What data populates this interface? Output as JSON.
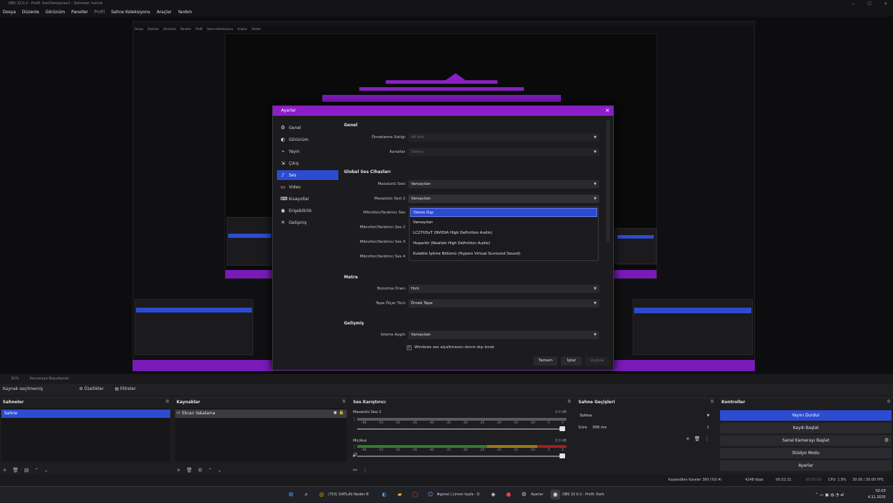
{
  "window": {
    "title": "OBS 32.0.2 - Profil: KartZamparası1 - Sahneler: komut",
    "controls": [
      "—",
      "☐",
      "✕"
    ]
  },
  "menu": [
    "Dosya",
    "Düzenle",
    "Görünüm",
    "Paneller",
    "Profil",
    "Sahne Koleksiyonu",
    "Araçlar",
    "Yardım"
  ],
  "nested_menu": [
    "Dosya",
    "Düzenle",
    "Görünüm",
    "Paneller",
    "Profil",
    "Sahne Koleksiyonu",
    "Araçlar",
    "Yardım"
  ],
  "dialog": {
    "title": "Ayarlar",
    "close": "✕",
    "nav": [
      {
        "label": "Genel",
        "icon": "⚙"
      },
      {
        "label": "Görünüm",
        "icon": "◐"
      },
      {
        "label": "Yayın",
        "icon": "⌁"
      },
      {
        "label": "Çıkış",
        "icon": "⇲"
      },
      {
        "label": "Ses",
        "icon": "♪"
      },
      {
        "label": "Video",
        "icon": "▭"
      },
      {
        "label": "Kısayollar",
        "icon": "⌨"
      },
      {
        "label": "Erişebilirlik",
        "icon": "◉"
      },
      {
        "label": "Gelişmiş",
        "icon": "✕"
      }
    ],
    "active_nav": "Ses",
    "sections": {
      "general": "Genel",
      "global_audio": "Global Ses Cihazları",
      "meters": "Metre",
      "advanced": "Gelişmiş"
    },
    "fields": {
      "sample_rate": {
        "label": "Örnekleme Sıklığı",
        "value": "48 kHz"
      },
      "channels": {
        "label": "Kanallar",
        "value": "Stereo"
      },
      "desktop1": {
        "label": "Masaüstü Sesi",
        "value": "Varsayılan"
      },
      "desktop2": {
        "label": "Masaüstü Sesi 2",
        "value": "Varsayılan"
      },
      "mic1": {
        "label": "Mikrofon/Yardımcı Ses"
      },
      "mic2": {
        "label": "Mikrofon/Yardımcı Ses 2"
      },
      "mic3": {
        "label": "Mikrofon/Yardımcı Ses 3"
      },
      "mic4": {
        "label": "Mikrofon/Yardımcı Ses 4"
      },
      "decay": {
        "label": "Bozulma Oranı",
        "value": "Hızlı"
      },
      "peak": {
        "label": "Tepe Ölçer Türü",
        "value": "Örnek Tepe"
      },
      "monitor": {
        "label": "İzleme Aygıtı",
        "value": "Varsayılan"
      },
      "ducking": {
        "label": "Windows ses alçaltmasını devre dışı bırak",
        "checked": "✓"
      }
    },
    "dropdown_options": [
      "Devre Dışı",
      "Varsayılan",
      "LC27G5xT (NVIDIA High Definition Audio)",
      "Hoparlör (Realtek High Definition Audio)",
      "Kulaklık İşitme Bölümü (Hyperx Virtual Surround Sound)"
    ],
    "dropdown_selected": "Devre Dışı",
    "buttons": {
      "ok": "Tamam",
      "cancel": "İptal",
      "apply": "Uygula"
    }
  },
  "zoom_strip": {
    "zoom": "92%",
    "fit": "Pencereye Boyutlandır"
  },
  "source_strip": {
    "label": "Kaynak seçilmemiş",
    "properties": "Özellikler",
    "filters": "Filtreler"
  },
  "docks": {
    "scenes": {
      "title": "Sahneler",
      "items": [
        "Sahne"
      ]
    },
    "sources": {
      "title": "Kaynaklar",
      "items": [
        "Ekran Yakalama"
      ]
    },
    "mixer": {
      "title": "Ses Karıştırıcı",
      "tracks": [
        {
          "name": "Masaüstü Sesi 2",
          "db": "0.0 dB"
        },
        {
          "name": "Mic/Aux",
          "db": "0.0 dB"
        }
      ],
      "ticks": [
        "-60",
        "-55",
        "-50",
        "-45",
        "-40",
        "-35",
        "-30",
        "-25",
        "-20",
        "-15",
        "-10",
        "-5",
        "0"
      ]
    },
    "transitions": {
      "title": "Sahne Geçişleri",
      "type": "Solma",
      "duration_label": "Süre",
      "duration": "300 ms"
    },
    "controls": {
      "title": "Kontroller",
      "buttons": [
        "Yayını Durdur",
        "Kaydı Başlat",
        "Sanal Kamerayı Başlat",
        "Stüdyo Modu",
        "Ayarlar"
      ]
    }
  },
  "status": {
    "dropped": "Kaybedilen Kareler 360 (%0.4)",
    "bitrate": "4248 kbps",
    "stream_time": "00:52:21",
    "rec_time": "00:00:00",
    "cpu": "CPU: 1.9%",
    "fps": "30.00 / 30.00 FPS"
  },
  "taskbar": {
    "items": [
      "(753) 3/ATLAS Neden B",
      "#genel | Limon tayfa - D",
      "Ayarlar",
      "OBS 32.0.2 - Profil: Kartı"
    ],
    "clock": "02:03",
    "date": "4.11.2025"
  },
  "colors": {
    "accent_purple": "#8b1ec9",
    "accent_blue": "#2d4bd1"
  }
}
